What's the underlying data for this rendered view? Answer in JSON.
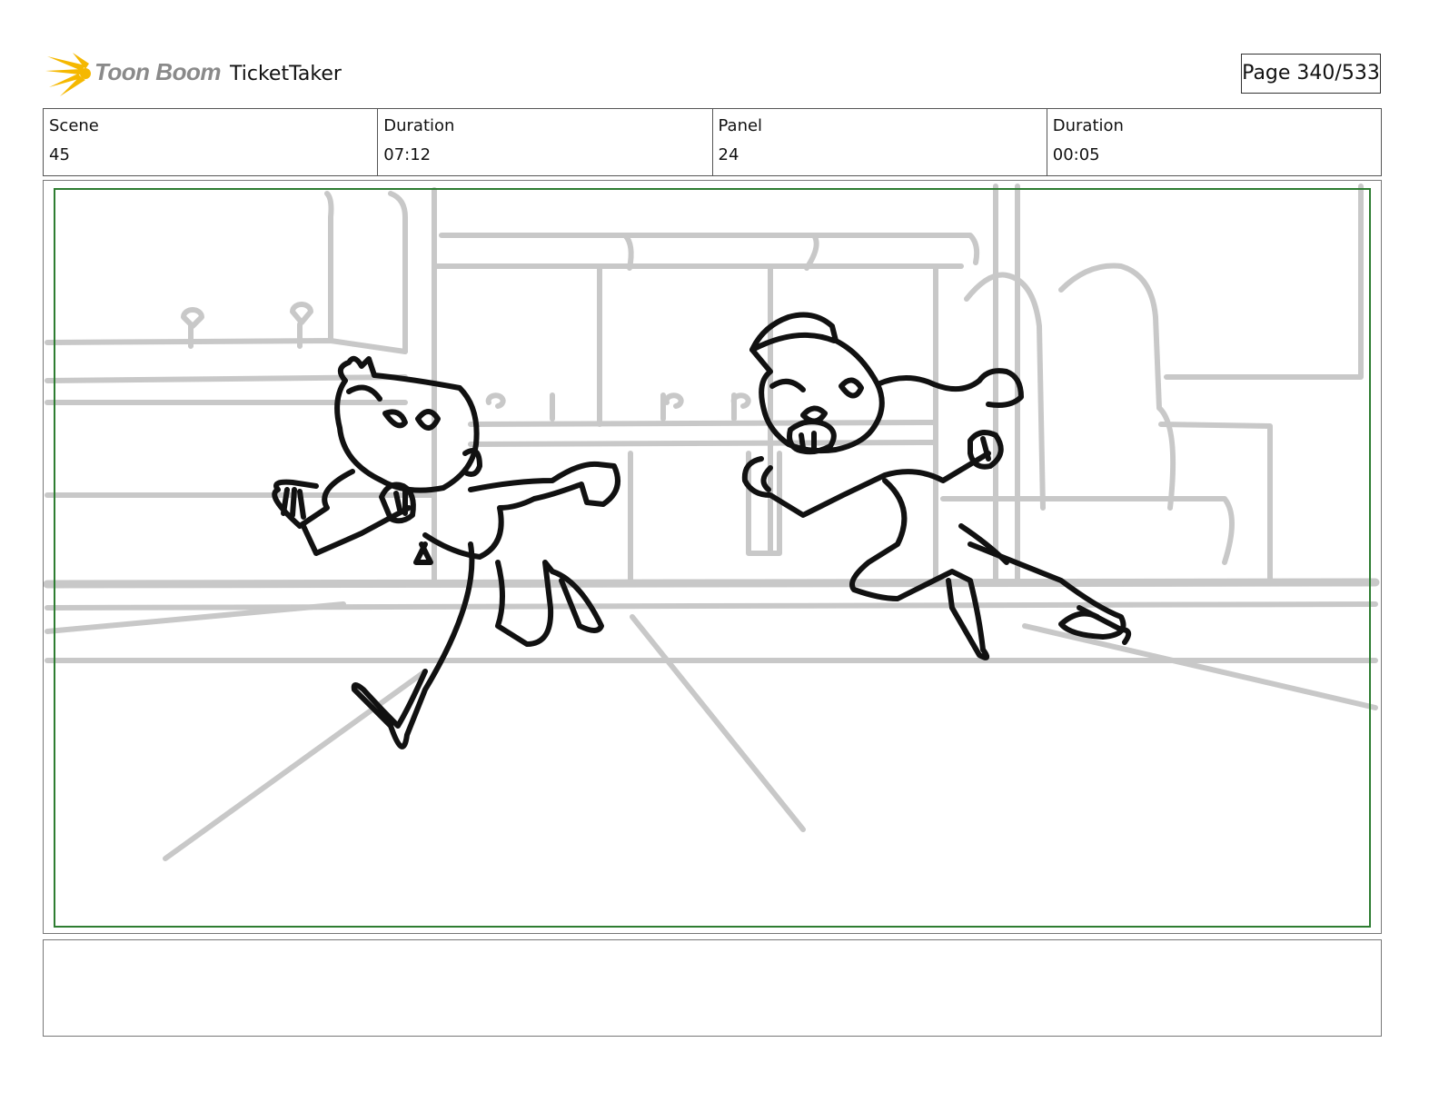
{
  "header": {
    "logo_text": "Toon Boom",
    "project_title": "TicketTaker",
    "page_indicator": "Page 340/533"
  },
  "info": {
    "scene_label": "Scene",
    "scene_value": "45",
    "scene_duration_label": "Duration",
    "scene_duration_value": "07:12",
    "panel_label": "Panel",
    "panel_value": "24",
    "panel_duration_label": "Duration",
    "panel_duration_value": "00:05"
  },
  "colors": {
    "logo_yellow": "#f5b800",
    "safe_area_green": "#2e7d32",
    "background_sketch": "#c8c8c8",
    "character_ink": "#111111"
  },
  "notes": {
    "text": ""
  }
}
